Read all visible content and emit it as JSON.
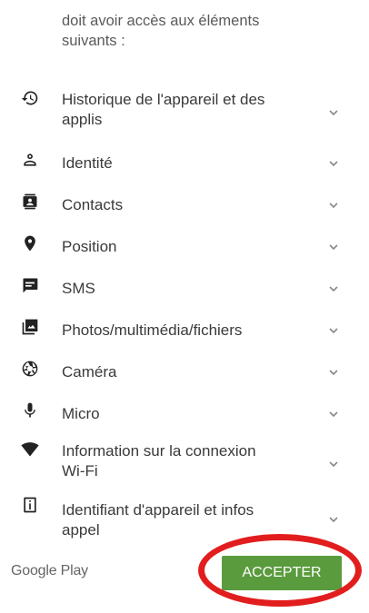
{
  "intro": {
    "line1": "doit avoir accès aux éléments",
    "line2": "suivants :"
  },
  "permissions": [
    {
      "icon": "history-icon",
      "label_line1": "Historique de l'appareil et des",
      "label_line2": "applis"
    },
    {
      "icon": "person-icon",
      "label_line1": "Identité",
      "label_line2": ""
    },
    {
      "icon": "contacts-icon",
      "label_line1": "Contacts",
      "label_line2": ""
    },
    {
      "icon": "location-pin-icon",
      "label_line1": "Position",
      "label_line2": ""
    },
    {
      "icon": "sms-icon",
      "label_line1": "SMS",
      "label_line2": ""
    },
    {
      "icon": "photo-icon",
      "label_line1": "Photos/multimédia/fichiers",
      "label_line2": ""
    },
    {
      "icon": "camera-icon",
      "label_line1": "Caméra",
      "label_line2": ""
    },
    {
      "icon": "microphone-icon",
      "label_line1": "Micro",
      "label_line2": ""
    },
    {
      "icon": "wifi-icon",
      "label_line1": "Information sur la connexion",
      "label_line2": "Wi-Fi"
    },
    {
      "icon": "device-info-icon",
      "label_line1": "Identifiant d'appareil et infos",
      "label_line2": "appel"
    }
  ],
  "footer": {
    "brand": "Google Play",
    "accept_label": "ACCEPTER"
  },
  "colors": {
    "accept_button": "#5a9b3d",
    "highlight_ring": "#e21d1d"
  }
}
